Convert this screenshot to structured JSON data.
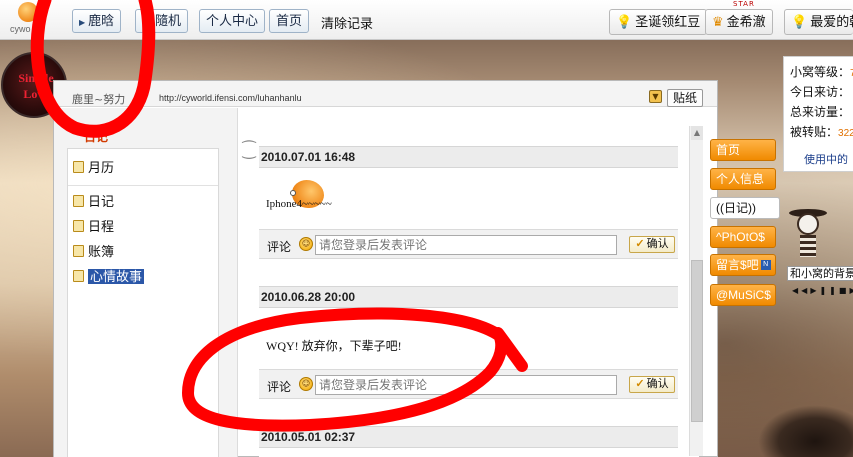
{
  "topbar": {
    "logo_text": "cywo",
    "tabs": [
      {
        "label": "鹿晗",
        "icon": "arrow-right-icon"
      },
      {
        "label": "隨机",
        "icon": "blue-dot-icon"
      },
      {
        "label": "个人中心"
      },
      {
        "label": "首页"
      }
    ],
    "clear_link": "清除记录",
    "right_tabs": [
      {
        "label": "圣诞领红豆",
        "icon": "bulb-icon"
      },
      {
        "label": "金希澈",
        "icon": "crown-icon"
      },
      {
        "label": "最爱的韩",
        "icon": "bulb-icon"
      }
    ],
    "star_label": "STAR"
  },
  "avatar": {
    "text": "Simple Love"
  },
  "panel": {
    "site_name": "鹿里~努力",
    "url": "http://cyworld.ifensi.com/luhanhanlu",
    "sticker_label": "贴纸",
    "sidebar": {
      "title": "日记",
      "items": [
        {
          "label": "月历",
          "icon": "calendar-icon"
        },
        {
          "label": "日记",
          "icon": "diary-icon"
        },
        {
          "label": "日程",
          "icon": "schedule-icon"
        },
        {
          "label": "账簿",
          "icon": "ledger-icon"
        },
        {
          "label": "心情故事",
          "icon": "mood-icon",
          "active": true
        }
      ]
    },
    "entries": [
      {
        "date": "2010.07.01 16:48",
        "text": "Iphone4~~~~~"
      },
      {
        "date": "2010.06.28 20:00",
        "text": "WQY! 放弃你，下辈子吧!"
      },
      {
        "date": "2010.05.01 02:37",
        "text": ""
      }
    ],
    "comment": {
      "label": "评论",
      "placeholder": "请您登录后发表评论",
      "confirm_label": "确认"
    }
  },
  "right_nav": [
    {
      "label": "首页"
    },
    {
      "label": "个人信息"
    },
    {
      "label": "((日记))",
      "current": true
    },
    {
      "label": "^PhOtO$"
    },
    {
      "label": "留言$吧",
      "badge": "N"
    },
    {
      "label": "@MuSiC$"
    }
  ],
  "stats": {
    "rows": [
      {
        "label": "小窝等级：",
        "value": "7"
      },
      {
        "label": "今日来访：",
        "value": ""
      },
      {
        "label": "总来访量：",
        "value": ""
      },
      {
        "label": "被转贴：",
        "value": "322"
      }
    ],
    "link": "使用中的"
  },
  "music": {
    "title": "和小窝的背景"
  }
}
